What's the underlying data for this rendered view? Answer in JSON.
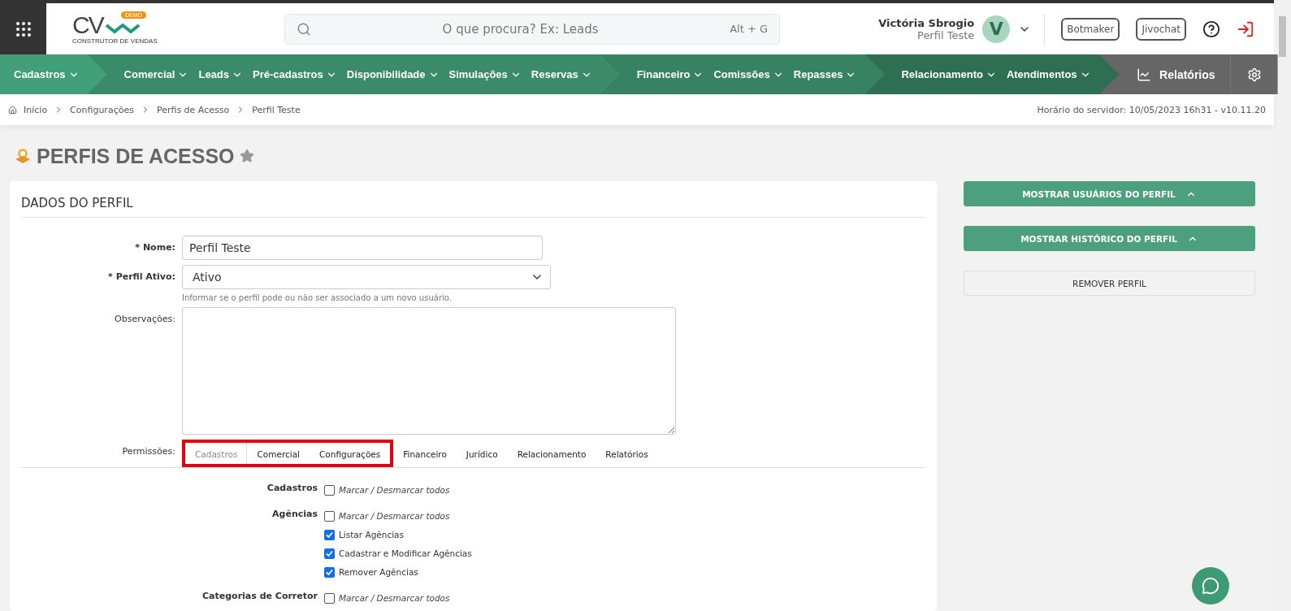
{
  "logo": {
    "letters": "CV",
    "badge": "DEMO",
    "tagline": "CONSTRUTOR DE VENDAS"
  },
  "search": {
    "placeholder": "O que procura? Ex: Leads",
    "shortcut": "Alt + G"
  },
  "user": {
    "name": "Victória Sbrogio",
    "profile": "Perfil Teste",
    "initial": "V"
  },
  "header_buttons": [
    "Botmaker",
    "Jivochat"
  ],
  "nav_groups": [
    {
      "items": [
        "Cadastros"
      ]
    },
    {
      "items": [
        "Comercial",
        "Leads",
        "Pré-cadastros",
        "Disponibilidade",
        "Simulações",
        "Reservas"
      ]
    },
    {
      "items": [
        "Financeiro",
        "Comissões",
        "Repasses"
      ]
    },
    {
      "items": [
        "Relacionamento",
        "Atendimentos"
      ]
    }
  ],
  "reports_link": "Relatórios",
  "breadcrumb": [
    "Início",
    "Configurações",
    "Perfis de Acesso",
    "Perfil Teste"
  ],
  "server_time": "Horário do servidor: 10/05/2023 16h31 - v10.11.20",
  "page_title": "PERFIS DE ACESSO",
  "favorite": false,
  "section_title": "DADOS DO PERFIL",
  "form": {
    "name_label": "* Nome:",
    "name_value": "Perfil Teste",
    "active_label": "* Perfil Ativo:",
    "active_value": "Ativo",
    "active_help": "Informar se o perfil pode ou não ser associado a um novo usuário.",
    "notes_label": "Observações:"
  },
  "permissions_label": "Permissões:",
  "tabs": [
    {
      "label": "Cadastros",
      "selected": true,
      "highlighted": true
    },
    {
      "label": "Comercial",
      "selected": false,
      "highlighted": true
    },
    {
      "label": "Configurações",
      "selected": false,
      "highlighted": true
    },
    {
      "label": "Financeiro",
      "selected": false,
      "highlighted": false
    },
    {
      "label": "Jurídico",
      "selected": false,
      "highlighted": false
    },
    {
      "label": "Relacionamento",
      "selected": false,
      "highlighted": false
    },
    {
      "label": "Relatórios",
      "selected": false,
      "highlighted": false
    }
  ],
  "permission_groups": [
    {
      "label": "Cadastros",
      "toggle": {
        "label": "Marcar / Desmarcar todos",
        "checked": false
      }
    },
    {
      "label": "Agências",
      "toggle": {
        "label": "Marcar / Desmarcar todos",
        "checked": false
      },
      "items": [
        {
          "label": "Listar Agências",
          "checked": true
        },
        {
          "label": "Cadastrar e Modificar Agências",
          "checked": true
        },
        {
          "label": "Remover Agências",
          "checked": true
        }
      ]
    },
    {
      "label": "Categorias de Corretor",
      "toggle": {
        "label": "Marcar / Desmarcar todos",
        "checked": false
      }
    }
  ],
  "side_buttons": [
    {
      "label": "MOSTRAR USUÁRIOS DO PERFIL",
      "kind": "toggle"
    },
    {
      "label": "MOSTRAR HISTÓRICO DO PERFIL",
      "kind": "toggle"
    },
    {
      "label": "REMOVER PERFIL",
      "kind": "plain"
    }
  ]
}
